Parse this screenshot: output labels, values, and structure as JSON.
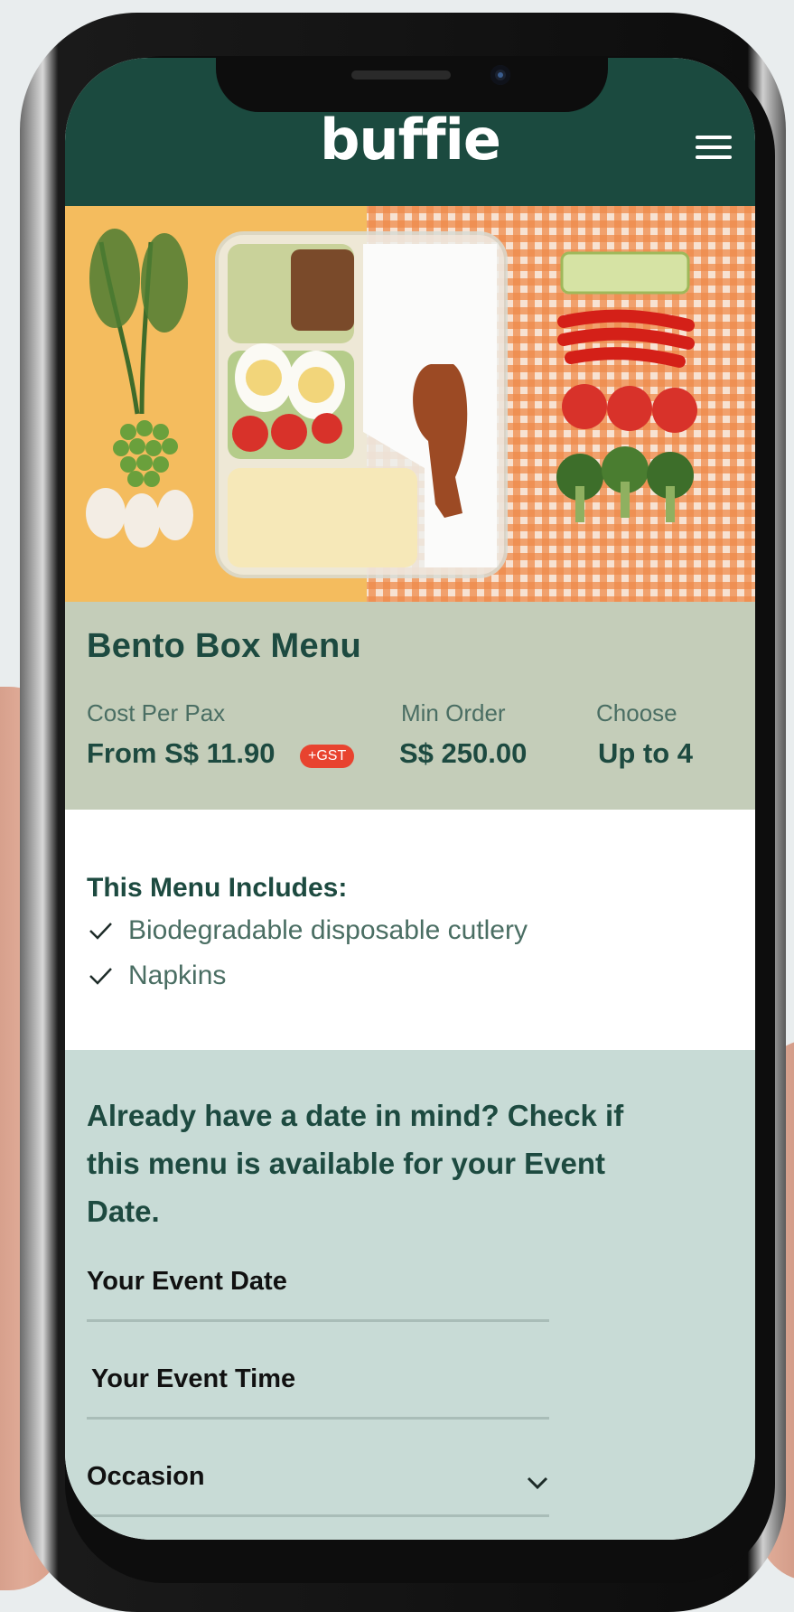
{
  "app": {
    "logo_text": "buffie",
    "brand_color": "#1b4a3f"
  },
  "header": {
    "menu_icon": "hamburger-menu-icon"
  },
  "menu": {
    "title": "Bento Box Menu",
    "stats": [
      {
        "label": "Cost Per Pax",
        "value": "From S$ 11.90",
        "badge": "+GST"
      },
      {
        "label": "Min Order",
        "value": "S$ 250.00"
      },
      {
        "label": "Choose",
        "value": "Up to 4"
      }
    ]
  },
  "includes": {
    "title": "This Menu Includes:",
    "items": [
      "Biodegradable disposable cutlery",
      "Napkins"
    ]
  },
  "availability": {
    "heading": "Already have a date in mind? Check if this menu is available for your Event Date.",
    "fields": {
      "date_label": "Your Event Date",
      "time_label": "Your Event Time",
      "occasion_label": "Occasion"
    }
  }
}
